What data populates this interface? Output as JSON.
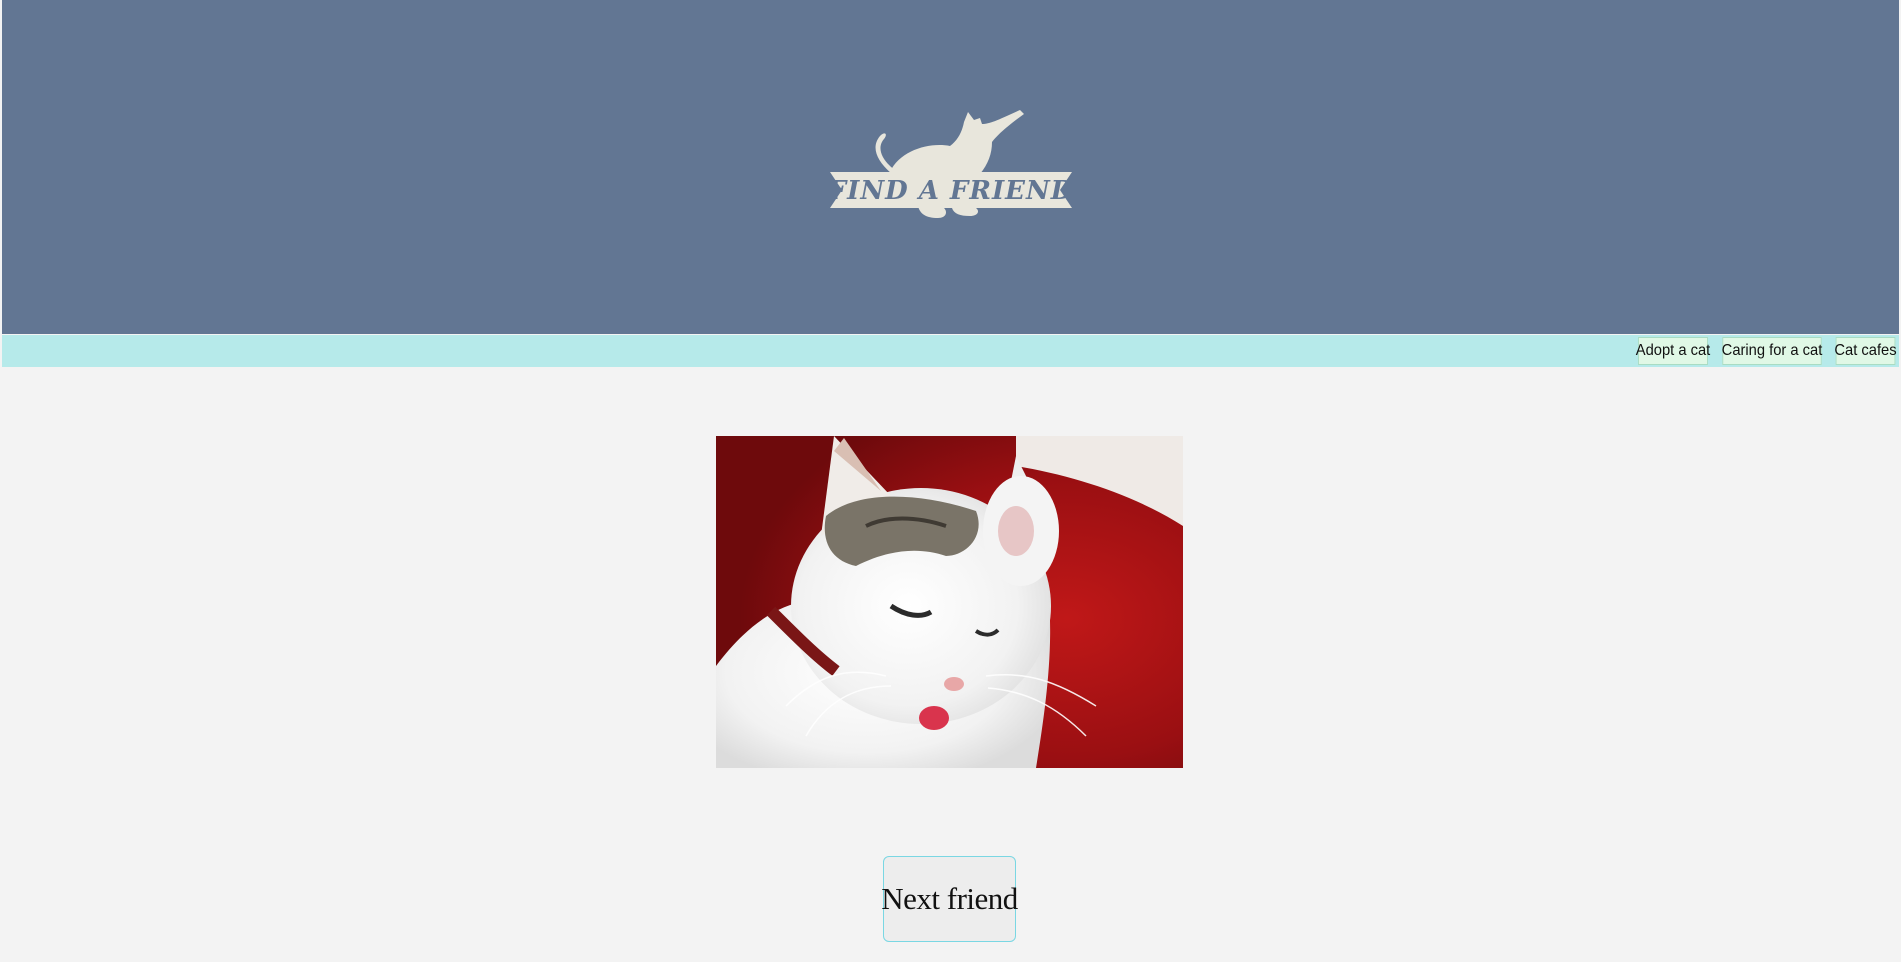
{
  "header": {
    "background_color": "#627693",
    "logo": {
      "text": "FIND A FRIEND",
      "icon": "cat-icon",
      "color": "#e8e6dc"
    }
  },
  "nav": {
    "background_color": "#b6eaea",
    "items": [
      {
        "label": "Adopt a cat"
      },
      {
        "label": "Caring for a cat"
      },
      {
        "label": "Cat cafes"
      }
    ]
  },
  "main": {
    "photo": {
      "subject": "cat-photo"
    },
    "next_button_label": "Next friend"
  }
}
